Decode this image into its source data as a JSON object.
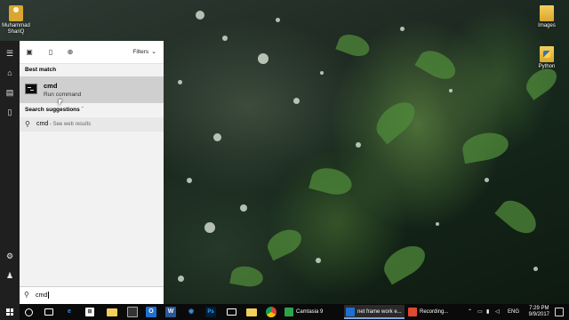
{
  "desktop": {
    "icons": [
      {
        "label": "Muhammad\nShariQ",
        "icon": "user-folder-icon"
      },
      {
        "label": "Images",
        "icon": "folder-icon"
      },
      {
        "label": "Python",
        "icon": "python-folder-icon"
      }
    ]
  },
  "start_menu": {
    "rail_icons": [
      "hamburger-icon",
      "home-icon",
      "documents-icon",
      "device-icon",
      "settings-icon",
      "user-icon"
    ],
    "top_icons": [
      "apps-icon",
      "documents-filter-icon",
      "web-icon"
    ],
    "filters_label": "Filters",
    "best_match_label": "Best match",
    "best_match": {
      "title": "cmd",
      "subtitle": "Run command",
      "icon": "command-prompt-icon"
    },
    "search_suggestions_label": "Search suggestions",
    "suggestions": [
      {
        "term": "cmd",
        "hint": " - See web results"
      }
    ],
    "search_value": "cmd"
  },
  "taskbar": {
    "apps": [
      {
        "label": "Camtasia 9",
        "color": "#2fa24a"
      },
      {
        "label": "net frame work e...",
        "color": "#1f6fd1"
      },
      {
        "label": "Recording...",
        "color": "#e04a2e"
      }
    ],
    "tray_language": "ENG",
    "time": "7:29 PM",
    "date": "9/9/2017"
  },
  "colors": {
    "start_rail": "#1f1f1f",
    "panel_bg": "#f2f2f2",
    "selected_row": "#cfcfcf",
    "taskbar": "#0a0a0a"
  }
}
